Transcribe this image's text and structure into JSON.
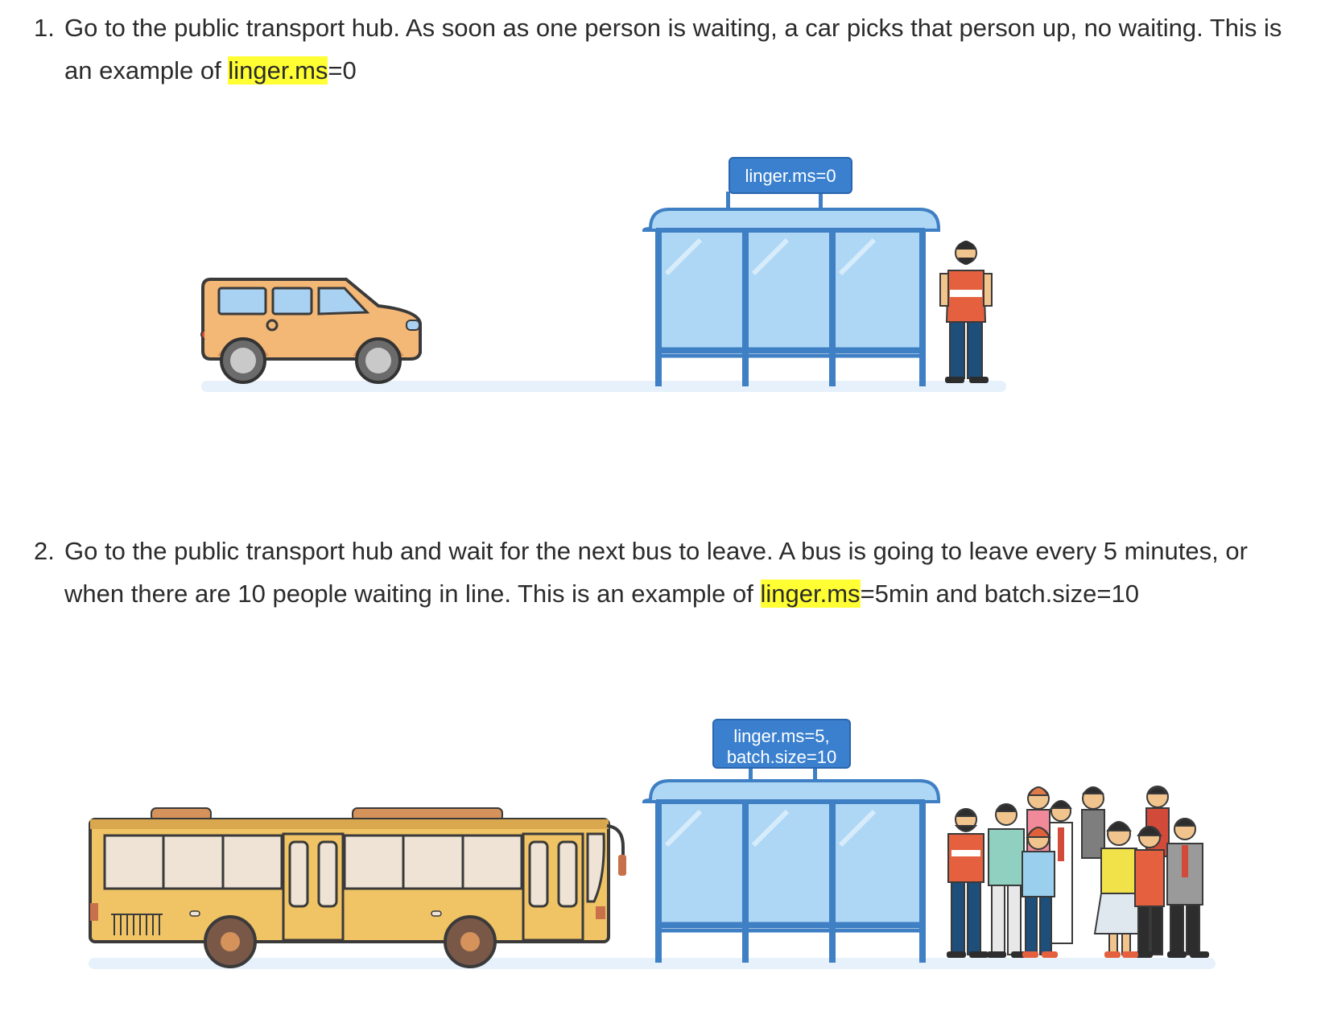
{
  "item1": {
    "number": "1.",
    "text_before": "Go to the public transport hub. As soon as one person is waiting, a car picks that person up, no waiting. This is an example of ",
    "highlight": "linger.ms",
    "text_after": "=0",
    "sign_line1": "linger.ms=0"
  },
  "item2": {
    "number": "2.",
    "text_before": "Go to the public transport hub and wait for the next bus to leave. A bus is going to leave every 5 minutes, or when there are 10 people waiting in line. This is an example of ",
    "highlight": "linger.ms",
    "text_after": "=5min and batch.size=10",
    "sign_line1": "linger.ms=5,",
    "sign_line2": "batch.size=10"
  },
  "colors": {
    "highlight": "#ffff33",
    "shelter_frame": "#3f7fc4",
    "shelter_glass": "#aed6f5",
    "sign": "#3a80cf",
    "car": "#f3b776",
    "bus": "#f0c465",
    "ground": "#e6f1fb"
  }
}
